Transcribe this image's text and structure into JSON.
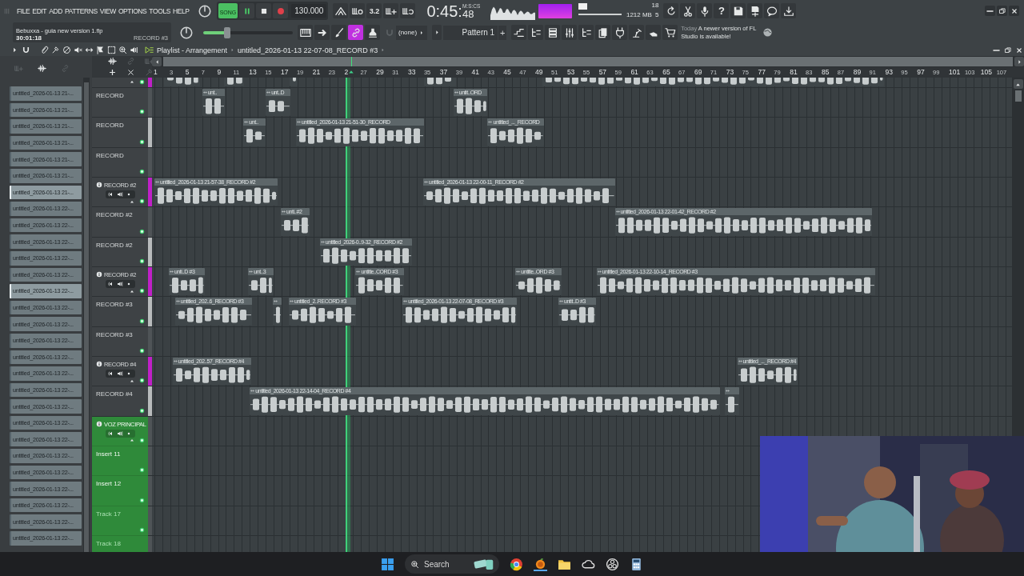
{
  "menu": [
    "FILE",
    "EDIT",
    "ADD",
    "PATTERNS",
    "VIEW",
    "OPTIONS",
    "TOOLS",
    "HELP"
  ],
  "transport": {
    "mode": "SONG",
    "song_mode": true,
    "playing": true,
    "tempo": "130.000"
  },
  "countdown": "3.2",
  "time": {
    "main": "0:45:",
    "sub": "48",
    "unit": "M:S:CS"
  },
  "monitor": {
    "cpu": "18",
    "memory": "1212 MB",
    "polyphony": "5"
  },
  "help": "?",
  "song": {
    "file": "Bebuxxa - guia new version 1.flp",
    "time": "30:01:18",
    "hint": "RECORD #3"
  },
  "master_slider": {
    "level": 0.27
  },
  "link_active": true,
  "snap": "(none)",
  "pattern": {
    "name": "Pattern 1",
    "add": "+"
  },
  "news": {
    "date": "Today",
    "text": "A newer version of FL Studio is available!"
  },
  "playlist": {
    "title": "Playlist - Arrangement",
    "clip": "untitled_2026-01-13 22-07-08_RECORD #3",
    "ruler": [
      "1",
      "3",
      "5",
      "7",
      "9",
      "11",
      "13",
      "15",
      "17",
      "19",
      "21",
      "23",
      "2",
      "27",
      "29",
      "31",
      "33",
      "35",
      "37",
      "39",
      "41",
      "43",
      "45",
      "47",
      "49",
      "51",
      "53",
      "55",
      "57",
      "59",
      "61",
      "63",
      "65",
      "67",
      "69",
      "71",
      "73",
      "75",
      "77",
      "79",
      "81",
      "83",
      "85",
      "87",
      "89",
      "91",
      "93",
      "95",
      "97",
      "99",
      "101",
      "103",
      "105",
      "107"
    ],
    "patterns": [
      {
        "label": "untitled_2026-01-13 21-...",
        "selected": false
      },
      {
        "label": "untitled_2026-01-13 21-...",
        "selected": false
      },
      {
        "label": "untitled_2026-01-13 21-...",
        "selected": false
      },
      {
        "label": "untitled_2026-01-13 21-...",
        "selected": false
      },
      {
        "label": "untitled_2026-01-13 21-...",
        "selected": false
      },
      {
        "label": "untitled_2026-01-13 21-...",
        "selected": false
      },
      {
        "label": "untitled_2026-01-13 21-...",
        "selected": true
      },
      {
        "label": "untitled_2026-01-13 22-...",
        "selected": false
      },
      {
        "label": "untitled_2026-01-13 22-...",
        "selected": false
      },
      {
        "label": "untitled_2026-01-13 22-...",
        "selected": false
      },
      {
        "label": "untitled_2026-01-13 22-...",
        "selected": false
      },
      {
        "label": "untitled_2026-01-13 22-...",
        "selected": false
      },
      {
        "label": "untitled_2026-01-13 22-...",
        "selected": true
      },
      {
        "label": "untitled_2026-01-13 22-...",
        "selected": false
      },
      {
        "label": "untitled_2026-01-13 22-...",
        "selected": false
      },
      {
        "label": "untitled_2026-01-13 22-...",
        "selected": false
      },
      {
        "label": "untitled_2026-01-13 22-...",
        "selected": false
      },
      {
        "label": "untitled_2026-01-13 22-...",
        "selected": false
      },
      {
        "label": "untitled_2026-01-13 22-...",
        "selected": false
      },
      {
        "label": "untitled_2026-01-13 22-...",
        "selected": false
      },
      {
        "label": "untitled_2026-01-13 22-...",
        "selected": false
      },
      {
        "label": "untitled_2026-01-13 22-...",
        "selected": false
      },
      {
        "label": "untitled_2026-01-13 22-...",
        "selected": false
      },
      {
        "label": "untitled_2026-01-13 22-...",
        "selected": false
      },
      {
        "label": "untitled_2026-01-13 22-...",
        "selected": false
      },
      {
        "label": "untitled_2026-01-13 22-...",
        "selected": false
      },
      {
        "label": "untitled_2026-01-13 22-...",
        "selected": false
      },
      {
        "label": "untitled_2026-01-13 22-...",
        "selected": false
      }
    ],
    "tracks": [
      {
        "kind": "record",
        "color": "#c020c8",
        "header": false,
        "caret": true,
        "clips": [
          {
            "kind": "partial"
          },
          {
            "kind": "partial"
          },
          {
            "kind": "partial"
          },
          {
            "kind": "partial"
          },
          {
            "kind": "partial"
          }
        ]
      },
      {
        "kind": "record",
        "name": "RECORD",
        "color": "#4f5457",
        "header": false,
        "caret": false,
        "clips": [
          {
            "label": "unt.."
          },
          {
            "label": "unt..D"
          },
          {
            "label": "untit..ORD"
          }
        ]
      },
      {
        "kind": "record",
        "name": "RECORD",
        "color": "#b9bcbd",
        "header": false,
        "caret": false,
        "clips": [
          {
            "label": "unt.."
          },
          {
            "label": "untitled_2026-01-13 21-51-30_RECORD"
          },
          {
            "label": "untitled_..._RECORD"
          }
        ]
      },
      {
        "kind": "record",
        "name": "RECORD",
        "color": "#4f5457",
        "header": false,
        "caret": false
      },
      {
        "kind": "record",
        "name": "RECORD #2",
        "color": "#c020c8",
        "header": true,
        "caret": true,
        "clips": [
          {
            "label": "untitled_2026-01-13 21-57-38_RECORD #2"
          },
          {
            "label": "untitled_2026-01-13 22-00-11_RECORD #2"
          }
        ]
      },
      {
        "kind": "record",
        "name": "RECORD #2",
        "color": "#4f5457",
        "header": false,
        "caret": false,
        "clips": [
          {
            "label": "unti..#2"
          },
          {
            "label": "untitled_2026-01-13 22-01-42_RECORD #2"
          }
        ]
      },
      {
        "kind": "record",
        "name": "RECORD #2",
        "color": "#b9bcbd",
        "header": false,
        "caret": false,
        "clips": [
          {
            "label": "untitled_2026-0..9-32_RECORD #2"
          }
        ]
      },
      {
        "kind": "record",
        "name": "RECORD #2",
        "color": "#c020c8",
        "header": true,
        "caret": true,
        "clips": [
          {
            "label": "unti..D #3"
          },
          {
            "label": "unt..3"
          },
          {
            "label": "untitle..CORD #3"
          },
          {
            "label": "untitle..ORD #3"
          },
          {
            "label": "untitled_2026-01-13 22-10-14_RECORD #3"
          }
        ]
      },
      {
        "kind": "record",
        "name": "RECORD #3",
        "color": "#b9bcbd",
        "header": false,
        "caret": false,
        "clips": [
          {
            "label": "untitled_202..6_RECORD #3"
          },
          {
            "kind": "audio"
          },
          {
            "label": "untitled_2..RECORD #3"
          },
          {
            "label": "untitled_2026-01-13 22-07-08_RECORD #3"
          },
          {
            "label": "untit..D #3"
          }
        ]
      },
      {
        "kind": "record",
        "name": "RECORD #3",
        "color": "#4f5457",
        "header": false,
        "caret": false
      },
      {
        "kind": "record",
        "name": "RECORD #4",
        "color": "#c020c8",
        "header": true,
        "caret": true,
        "clips": [
          {
            "label": "untitled_202..57_RECORD #4"
          },
          {
            "label": "untitled_..._RECORD #4"
          }
        ]
      },
      {
        "kind": "record",
        "name": "RECORD #4",
        "color": "#b9bcbd",
        "header": false,
        "caret": false,
        "clips": [
          {
            "label": "untitled_2026-01-13 22-14-04_RECORD #4"
          },
          {
            "kind": "audio"
          }
        ]
      },
      {
        "kind": "group",
        "name": "VOZ PRINCIPAL",
        "color": "#4f5457",
        "header": true,
        "caret": true,
        "dimmed": false
      },
      {
        "kind": "group",
        "name": "Insert 11",
        "color": "#4f5457",
        "header": false,
        "caret": false,
        "dimmed": false
      },
      {
        "kind": "group",
        "name": "Insert 12",
        "color": "#4f5457",
        "header": false,
        "caret": false,
        "dimmed": false
      },
      {
        "kind": "group",
        "name": "Track 17",
        "color": "#4f5457",
        "header": false,
        "caret": false,
        "dimmed": true
      },
      {
        "kind": "group",
        "name": "Track 18",
        "color": "#4f5457",
        "header": false,
        "caret": false,
        "dimmed": true
      }
    ]
  },
  "taskbar": {
    "placeholder": "Search"
  }
}
